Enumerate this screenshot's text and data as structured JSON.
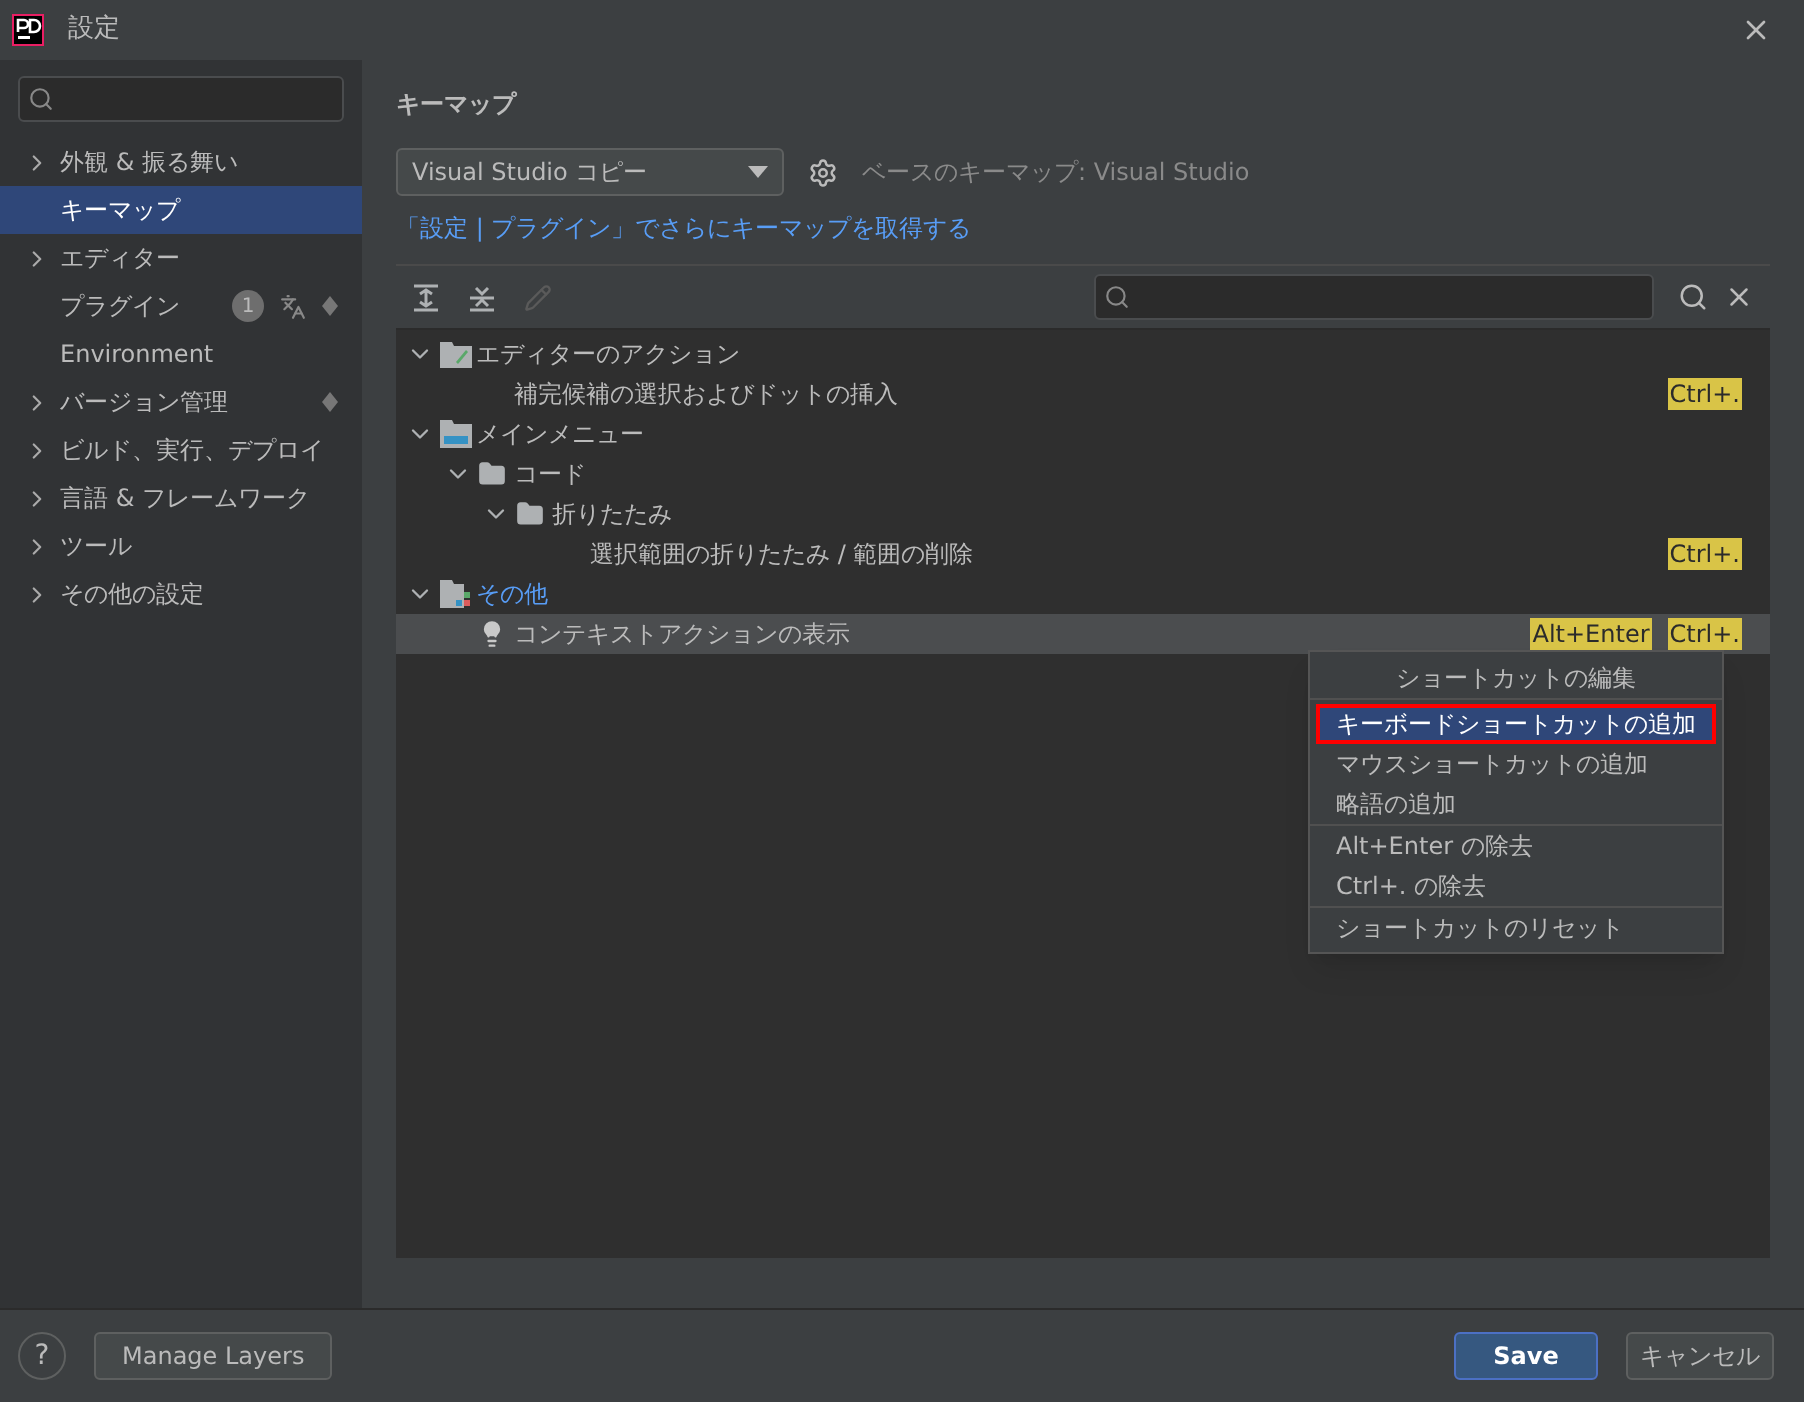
{
  "window": {
    "title": "設定"
  },
  "sidebar": {
    "items": [
      {
        "label": "外観 & 振る舞い",
        "expandable": true,
        "selected": false
      },
      {
        "label": "キーマップ",
        "expandable": false,
        "selected": true
      },
      {
        "label": "エディター",
        "expandable": true,
        "selected": false
      },
      {
        "label": "プラグイン",
        "expandable": false,
        "selected": false,
        "badge": "1",
        "translate": true,
        "synced": true
      },
      {
        "label": "Environment",
        "expandable": false,
        "selected": false
      },
      {
        "label": "バージョン管理",
        "expandable": true,
        "selected": false,
        "synced": true
      },
      {
        "label": "ビルド、実行、デプロイ",
        "expandable": true,
        "selected": false
      },
      {
        "label": "言語 & フレームワーク",
        "expandable": true,
        "selected": false
      },
      {
        "label": "ツール",
        "expandable": true,
        "selected": false
      },
      {
        "label": "その他の設定",
        "expandable": true,
        "selected": false
      }
    ]
  },
  "page": {
    "title": "キーマップ",
    "keymap_select": "Visual Studio コピー",
    "base_keymap": "ベースのキーマップ: Visual Studio",
    "plugin_link": "「設定 | プラグイン」でさらにキーマップを取得する"
  },
  "tree": {
    "nodes": [
      {
        "kind": "editor",
        "label": "エディターのアクション",
        "expanded": true,
        "children": [
          {
            "kind": "action",
            "label": "補完候補の選択およびドットの挿入",
            "shortcuts": [
              "Ctrl+."
            ],
            "selected": false
          }
        ]
      },
      {
        "kind": "mainmenu",
        "label": "メインメニュー",
        "expanded": true,
        "children": [
          {
            "kind": "folder",
            "label": "コード",
            "expanded": true,
            "children": [
              {
                "kind": "folder",
                "label": "折りたたみ",
                "expanded": true,
                "children": [
                  {
                    "kind": "action",
                    "label": "選択範囲の折りたたみ / 範囲の削除",
                    "shortcuts": [
                      "Ctrl+."
                    ],
                    "selected": false
                  }
                ]
              }
            ]
          }
        ]
      },
      {
        "kind": "other",
        "label": "その他",
        "expanded": true,
        "highlight": true,
        "children": [
          {
            "kind": "intention",
            "label": "コンテキストアクションの表示",
            "shortcuts": [
              "Alt+Enter",
              "Ctrl+."
            ],
            "selected": true
          }
        ]
      }
    ]
  },
  "context_menu": {
    "title": "ショートカットの編集",
    "groups": [
      [
        {
          "label": "キーボードショートカットの追加",
          "selected": true,
          "annotated": true
        },
        {
          "label": "マウスショートカットの追加",
          "selected": false,
          "annotated": false
        },
        {
          "label": "略語の追加",
          "selected": false,
          "annotated": false
        }
      ],
      [
        {
          "label": "Alt+Enter の除去",
          "selected": false,
          "annotated": false
        },
        {
          "label": "Ctrl+. の除去",
          "selected": false,
          "annotated": false
        }
      ],
      [
        {
          "label": "ショートカットのリセット",
          "selected": false,
          "annotated": false
        }
      ]
    ]
  },
  "footer": {
    "help": "?",
    "manage_layers": "Manage Layers",
    "save": "Save",
    "cancel": "キャンセル"
  }
}
